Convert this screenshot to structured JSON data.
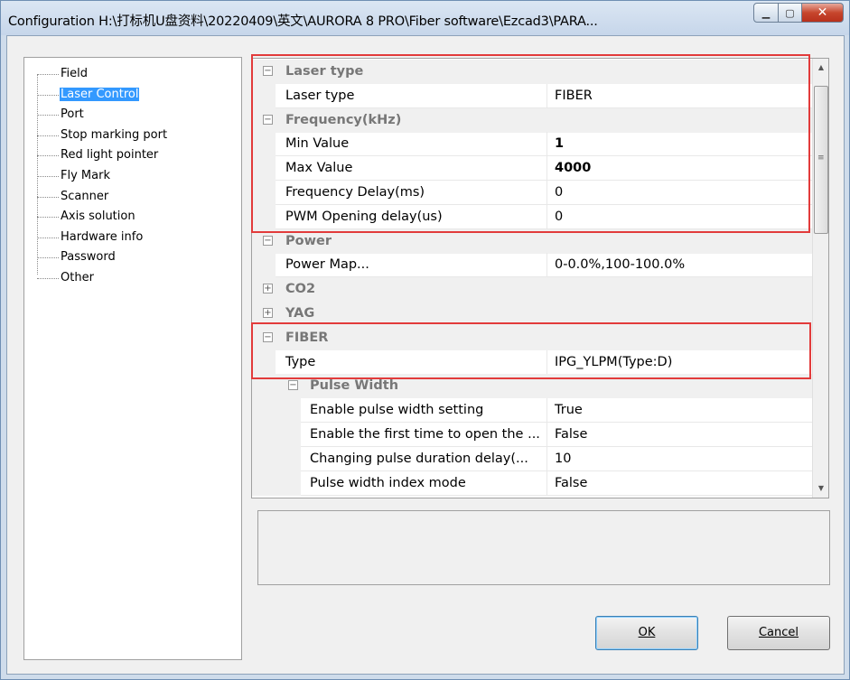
{
  "window": {
    "title": "Configuration H:\\打标机U盘资料\\20220409\\英文\\AURORA 8 PRO\\Fiber software\\Ezcad3\\PARA...",
    "minimize_icon": "minimize-icon",
    "maximize_icon": "maximize-icon",
    "close_icon": "close-icon"
  },
  "tree": {
    "items": [
      {
        "label": "Field",
        "selected": false
      },
      {
        "label": "Laser Control",
        "selected": true
      },
      {
        "label": "Port",
        "selected": false
      },
      {
        "label": "Stop marking port",
        "selected": false
      },
      {
        "label": "Red light pointer",
        "selected": false
      },
      {
        "label": "Fly Mark",
        "selected": false
      },
      {
        "label": "Scanner",
        "selected": false
      },
      {
        "label": "Axis solution",
        "selected": false
      },
      {
        "label": "Hardware info",
        "selected": false
      },
      {
        "label": "Password",
        "selected": false
      },
      {
        "label": "Other",
        "selected": false
      }
    ]
  },
  "grid": {
    "rows": [
      {
        "kind": "category",
        "label": "Laser type",
        "toggle": "⊟"
      },
      {
        "kind": "property",
        "label": "Laser type",
        "value": "FIBER"
      },
      {
        "kind": "category",
        "label": "Frequency(kHz)",
        "toggle": "⊟"
      },
      {
        "kind": "property",
        "label": "Min Value",
        "value": "1",
        "bold": true
      },
      {
        "kind": "property",
        "label": "Max Value",
        "value": "4000",
        "bold": true
      },
      {
        "kind": "property",
        "label": "Frequency Delay(ms)",
        "value": "0"
      },
      {
        "kind": "property",
        "label": "PWM Opening delay(us)",
        "value": "0"
      },
      {
        "kind": "category",
        "label": "Power",
        "toggle": "⊟"
      },
      {
        "kind": "property",
        "label": "Power Map...",
        "value": "0-0.0%,100-100.0%"
      },
      {
        "kind": "category",
        "label": "CO2",
        "toggle": "⊞"
      },
      {
        "kind": "category",
        "label": "YAG",
        "toggle": "⊞"
      },
      {
        "kind": "category",
        "label": "FIBER",
        "toggle": "⊟"
      },
      {
        "kind": "property",
        "label": "Type",
        "value": "IPG_YLPM(Type:D)"
      },
      {
        "kind": "subcategory",
        "label": "Pulse Width",
        "toggle": "⊟"
      },
      {
        "kind": "subproperty",
        "label": "Enable pulse width setting",
        "value": "True"
      },
      {
        "kind": "subproperty",
        "label": "Enable the first time to open the ...",
        "value": "False"
      },
      {
        "kind": "subproperty",
        "label": "Changing pulse duration delay(...",
        "value": "10"
      },
      {
        "kind": "subproperty",
        "label": "Pulse width index mode",
        "value": "False"
      }
    ],
    "scroll_up_icon": "▲",
    "scroll_down_icon": "▼",
    "grip_icon": "≡"
  },
  "buttons": {
    "ok_label": "OK",
    "cancel_label": "Cancel"
  },
  "colors": {
    "highlight": "#e23b3b",
    "selection": "#3399ff"
  }
}
